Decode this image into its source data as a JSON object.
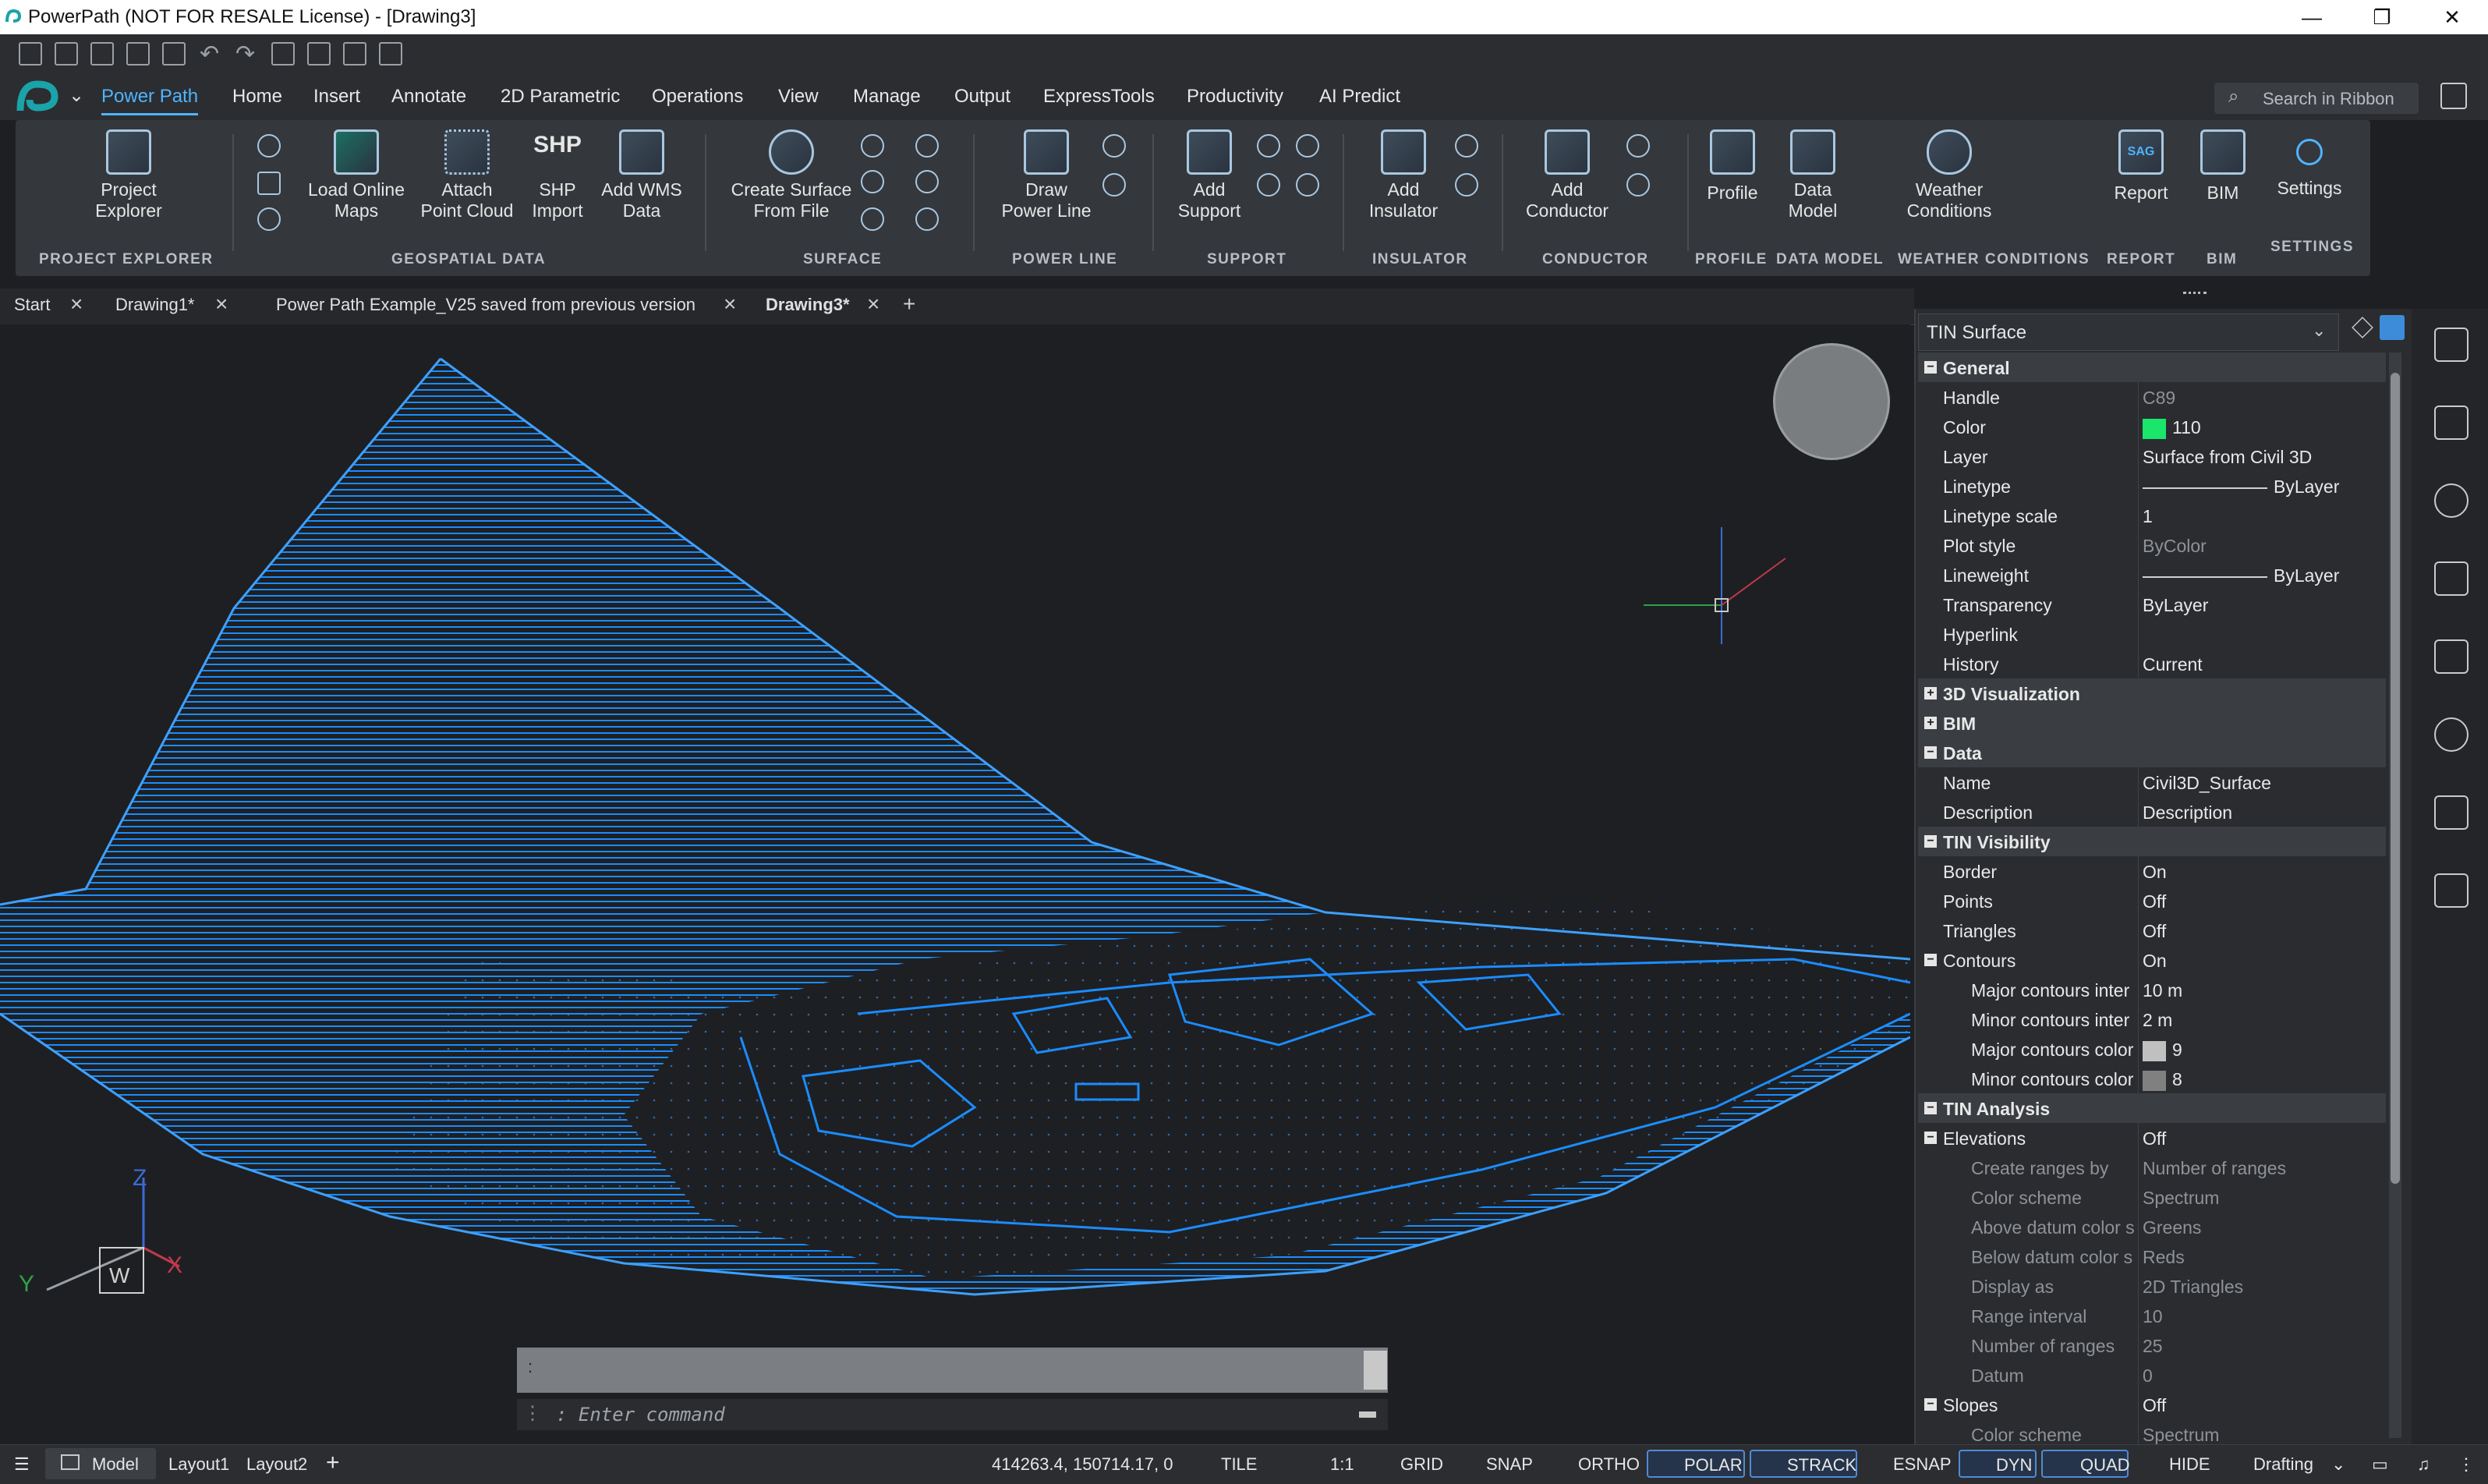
{
  "titlebar": {
    "title": "PowerPath (NOT FOR RESALE License) - [Drawing3]"
  },
  "ribbon": {
    "tabs": [
      "Power Path",
      "Home",
      "Insert",
      "Annotate",
      "2D Parametric",
      "Operations",
      "View",
      "Manage",
      "Output",
      "ExpressTools",
      "Productivity",
      "AI Predict"
    ],
    "search_placeholder": "Search in Ribbon",
    "groups": {
      "project_explorer": {
        "title": "PROJECT EXPLORER",
        "btn": [
          "Project",
          "Explorer"
        ]
      },
      "geospatial": {
        "title": "GEOSPATIAL DATA",
        "load_maps": [
          "Load Online",
          "Maps"
        ],
        "attach_pc": [
          "Attach",
          "Point Cloud"
        ],
        "shp_import": [
          "SHP",
          "Import"
        ],
        "wms": [
          "Add WMS",
          "Data"
        ],
        "shp_icon_text": "SHP"
      },
      "surface": {
        "title": "SURFACE",
        "btn": [
          "Create Surface",
          "From File"
        ]
      },
      "power_line": {
        "title": "POWER LINE",
        "btn": [
          "Draw",
          "Power Line"
        ]
      },
      "support": {
        "title": "SUPPORT",
        "btn": [
          "Add",
          "Support"
        ]
      },
      "insulator": {
        "title": "INSULATOR",
        "btn": [
          "Add",
          "Insulator"
        ]
      },
      "conductor": {
        "title": "CONDUCTOR",
        "btn": [
          "Add",
          "Conductor"
        ]
      },
      "profile": {
        "title": "PROFILE",
        "btn": "Profile"
      },
      "data_model": {
        "title": "DATA MODEL",
        "btn": [
          "Data",
          "Model"
        ]
      },
      "weather": {
        "title": "WEATHER CONDITIONS",
        "btn": [
          "Weather",
          "Conditions"
        ]
      },
      "report": {
        "title": "REPORT",
        "btn": "Report",
        "icon_text": "SAG"
      },
      "bim": {
        "title": "BIM",
        "btn": "BIM"
      },
      "settings": {
        "title": "SETTINGS",
        "btn": "Settings"
      }
    }
  },
  "doc_tabs": [
    "Start",
    "Drawing1*",
    "Power Path Example_V25 saved from previous version",
    "Drawing3*"
  ],
  "viewport": {
    "ucs": {
      "z": "Z",
      "y": "Y",
      "x": "X",
      "w": "W"
    }
  },
  "command": {
    "history": ":",
    "prompt": ": Enter command"
  },
  "properties": {
    "selector": "TIN Surface",
    "rows": [
      {
        "type": "sect",
        "k": "General",
        "tog": "−"
      },
      {
        "k": "Handle",
        "v": "C89",
        "dim_v": true
      },
      {
        "k": "Color",
        "v": "110",
        "swatch": "#19e66a"
      },
      {
        "k": "Layer",
        "v": "Surface from Civil 3D"
      },
      {
        "k": "Linetype",
        "v": "ByLayer",
        "line": true
      },
      {
        "k": "Linetype scale",
        "v": "1"
      },
      {
        "k": "Plot style",
        "v": "ByColor",
        "dim_v": true
      },
      {
        "k": "Lineweight",
        "v": "ByLayer",
        "line": true
      },
      {
        "k": "Transparency",
        "v": "ByLayer"
      },
      {
        "k": "Hyperlink",
        "v": ""
      },
      {
        "k": "History",
        "v": "Current"
      },
      {
        "type": "sect",
        "k": "3D Visualization",
        "tog": "+"
      },
      {
        "type": "sect",
        "k": "BIM",
        "tog": "+"
      },
      {
        "type": "sect",
        "k": "Data",
        "tog": "−"
      },
      {
        "k": "Name",
        "v": "Civil3D_Surface"
      },
      {
        "k": "Description",
        "v": "Description"
      },
      {
        "type": "sect",
        "k": "TIN Visibility",
        "tog": "−"
      },
      {
        "k": "Border",
        "v": "On"
      },
      {
        "k": "Points",
        "v": "Off"
      },
      {
        "k": "Triangles",
        "v": "Off"
      },
      {
        "k": "Contours",
        "v": "On",
        "tog": "−"
      },
      {
        "k": "Major contours inter",
        "v": "10 m",
        "sub": true
      },
      {
        "k": "Minor contours inter",
        "v": "2 m",
        "sub": true
      },
      {
        "k": "Major contours color",
        "v": "9",
        "sub": true,
        "swatch": "#c0c0c0"
      },
      {
        "k": "Minor contours color",
        "v": "8",
        "sub": true,
        "swatch": "#808080"
      },
      {
        "type": "sect",
        "k": "TIN Analysis",
        "tog": "−"
      },
      {
        "k": "Elevations",
        "v": "Off",
        "tog": "−"
      },
      {
        "k": "Create ranges by",
        "v": "Number of ranges",
        "sub": true,
        "dim": true
      },
      {
        "k": "Color scheme",
        "v": "Spectrum",
        "sub": true,
        "dim": true
      },
      {
        "k": "Above datum color s",
        "v": "Greens",
        "sub": true,
        "dim": true
      },
      {
        "k": "Below datum color s",
        "v": "Reds",
        "sub": true,
        "dim": true
      },
      {
        "k": "Display as",
        "v": "2D Triangles",
        "sub": true,
        "dim": true
      },
      {
        "k": "Range interval",
        "v": "10",
        "sub": true,
        "dim": true
      },
      {
        "k": "Number of ranges",
        "v": "25",
        "sub": true,
        "dim": true
      },
      {
        "k": "Datum",
        "v": "0",
        "sub": true,
        "dim": true
      },
      {
        "k": "Slopes",
        "v": "Off",
        "tog": "−"
      },
      {
        "k": "Color scheme",
        "v": "Spectrum",
        "sub": true,
        "dim": true
      }
    ]
  },
  "status": {
    "model": "Model",
    "layout1": "Layout1",
    "layout2": "Layout2",
    "coords": "414263.4, 150714.17, 0",
    "tile": "TILE",
    "scale": "1:1",
    "grid": "GRID",
    "snap": "SNAP",
    "ortho": "ORTHO",
    "polar": "POLAR",
    "strack": "STRACK",
    "esnap": "ESNAP",
    "dyn": "DYN",
    "quad": "QUAD",
    "hide": "HIDE",
    "workspace": "Drafting"
  },
  "colors": {
    "accent": "#4fb4ff",
    "surface": "#1a8cff",
    "background": "#1e1f22"
  }
}
